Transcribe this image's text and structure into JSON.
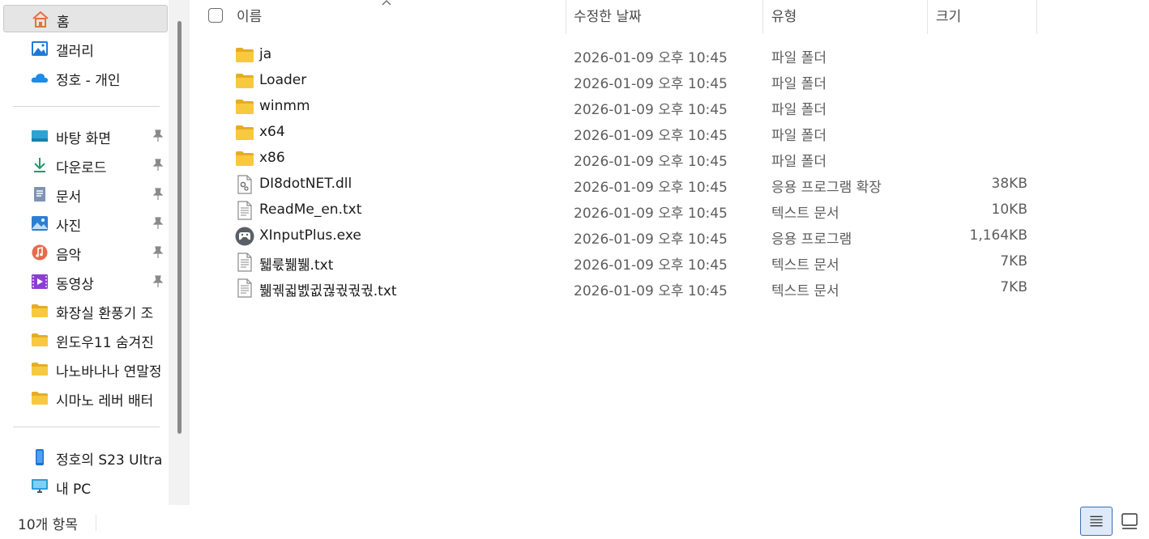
{
  "sidebar": {
    "quick": [
      {
        "label": "홈",
        "icon": "home-icon",
        "selected": true
      },
      {
        "label": "갤러리",
        "icon": "gallery-icon"
      },
      {
        "label": "정호 - 개인",
        "icon": "onedrive-cloud-icon"
      }
    ],
    "pinned": [
      {
        "label": "바탕 화면",
        "icon": "desktop-icon",
        "pinned": true
      },
      {
        "label": "다운로드",
        "icon": "download-icon",
        "pinned": true
      },
      {
        "label": "문서",
        "icon": "documents-icon",
        "pinned": true
      },
      {
        "label": "사진",
        "icon": "pictures-icon",
        "pinned": true
      },
      {
        "label": "음악",
        "icon": "music-icon",
        "pinned": true
      },
      {
        "label": "동영상",
        "icon": "videos-icon",
        "pinned": true
      },
      {
        "label": "화장실 환풍기 조",
        "icon": "folder-icon"
      },
      {
        "label": "윈도우11 숨겨진",
        "icon": "folder-icon"
      },
      {
        "label": "나노바나나 연말정",
        "icon": "folder-icon"
      },
      {
        "label": "시마노 레버 배터",
        "icon": "folder-icon"
      }
    ],
    "devices": [
      {
        "label": "정호의 S23 Ultra",
        "icon": "phone-icon"
      },
      {
        "label": "내 PC",
        "icon": "pc-icon"
      }
    ]
  },
  "columns": {
    "name": "이름",
    "date": "수정한 날짜",
    "type": "유형",
    "size": "크기"
  },
  "files": [
    {
      "name": "ja",
      "date": "2026-01-09 오후 10:45",
      "type": "파일 폴더",
      "size": "",
      "icon": "folder-icon"
    },
    {
      "name": "Loader",
      "date": "2026-01-09 오후 10:45",
      "type": "파일 폴더",
      "size": "",
      "icon": "folder-icon"
    },
    {
      "name": "winmm",
      "date": "2026-01-09 오후 10:45",
      "type": "파일 폴더",
      "size": "",
      "icon": "folder-icon"
    },
    {
      "name": "x64",
      "date": "2026-01-09 오후 10:45",
      "type": "파일 폴더",
      "size": "",
      "icon": "folder-icon"
    },
    {
      "name": "x86",
      "date": "2026-01-09 오후 10:45",
      "type": "파일 폴더",
      "size": "",
      "icon": "folder-icon"
    },
    {
      "name": "DI8dotNET.dll",
      "date": "2026-01-09 오후 10:45",
      "type": "응용 프로그램 확장",
      "size": "38KB",
      "icon": "dll-file-icon"
    },
    {
      "name": "ReadMe_en.txt",
      "date": "2026-01-09 오후 10:45",
      "type": "텍스트 문서",
      "size": "10KB",
      "icon": "text-file-icon"
    },
    {
      "name": "XInputPlus.exe",
      "date": "2026-01-09 오후 10:45",
      "type": "응용 프로그램",
      "size": "1,164KB",
      "icon": "gamepad-app-icon"
    },
    {
      "name": "뒓룫뷂뷂.txt",
      "date": "2026-01-09 오후 10:45",
      "type": "텍스트 문서",
      "size": "7KB",
      "icon": "text-file-icon"
    },
    {
      "name": "뷂궦귋벬귒궎궋궋궋.txt",
      "date": "2026-01-09 오후 10:45",
      "type": "텍스트 문서",
      "size": "7KB",
      "icon": "text-file-icon"
    }
  ],
  "status": {
    "count": "10개 항목"
  },
  "colors": {
    "folder": "#f8c93e",
    "folder_dark": "#e5ac26",
    "accent": "#0067c0",
    "selected_bg": "#e5e5e5"
  }
}
